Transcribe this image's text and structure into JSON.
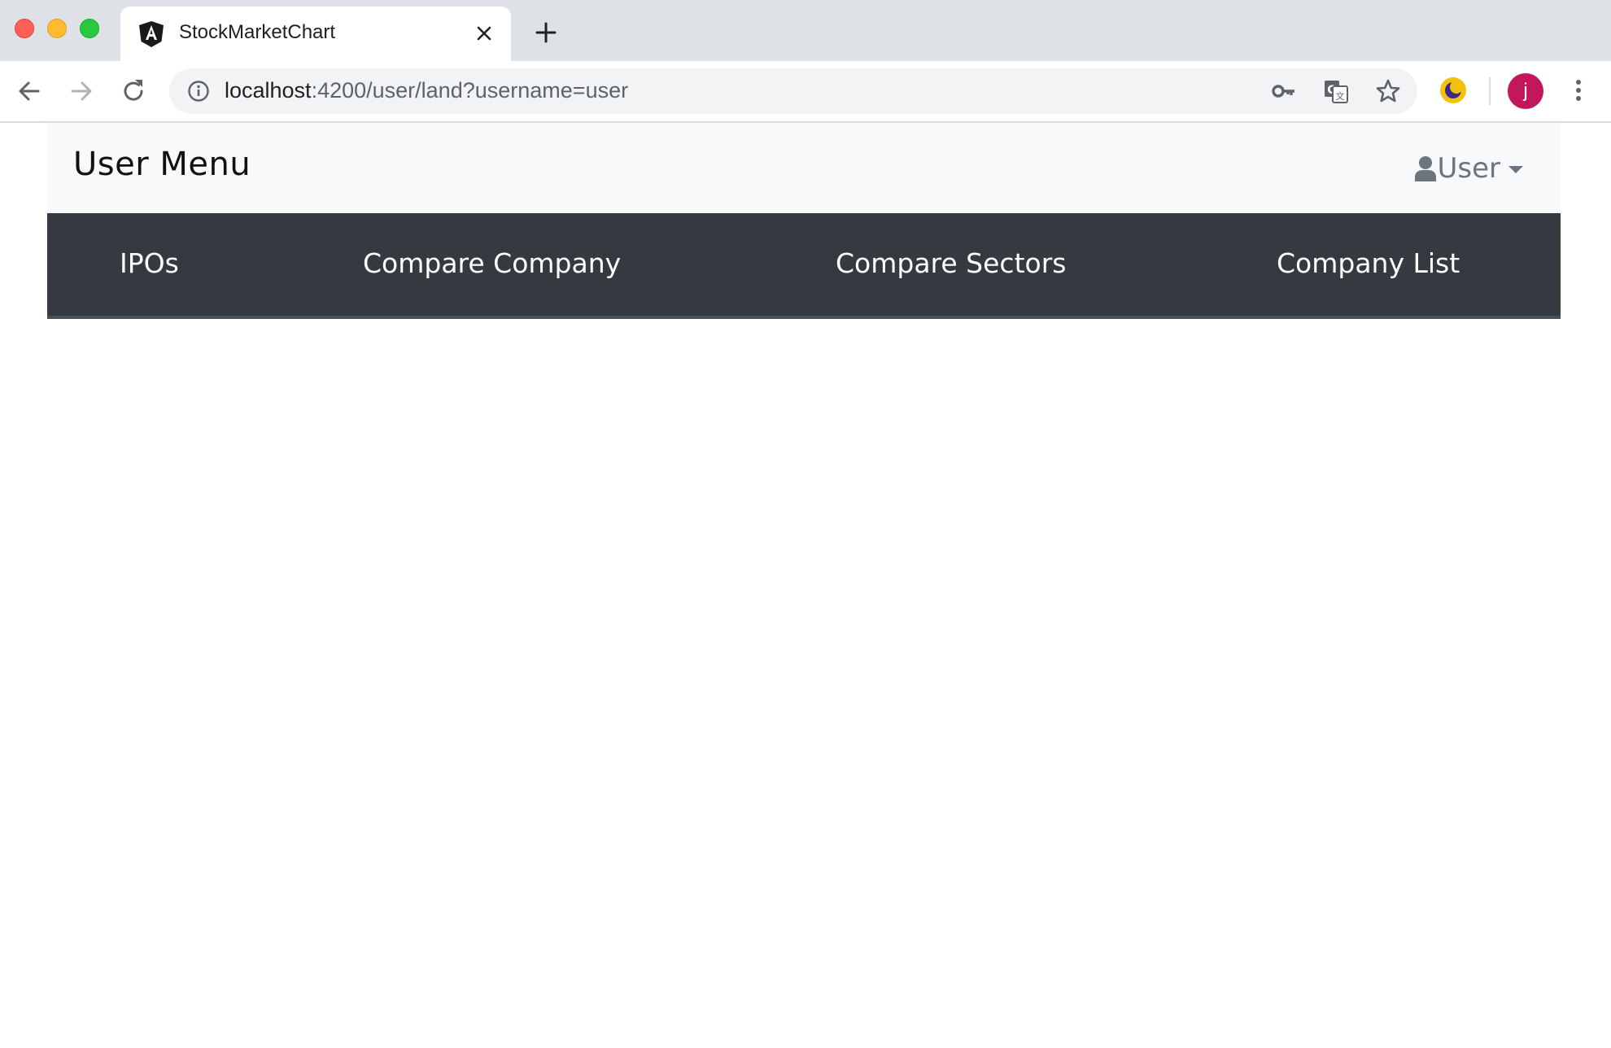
{
  "browser": {
    "tab": {
      "title": "StockMarketChart",
      "favicon": "angular-icon"
    },
    "url": {
      "host": "localhost",
      "path": ":4200/user/land?username=user"
    },
    "profile_initial": "j"
  },
  "header": {
    "brand": "User Menu",
    "user_menu_label": "User"
  },
  "nav": {
    "items": [
      {
        "label": "IPOs"
      },
      {
        "label": "Compare Company"
      },
      {
        "label": "Compare Sectors"
      },
      {
        "label": "Company List"
      }
    ]
  },
  "colors": {
    "header_bg": "#f8f9fa",
    "navbar_bg": "#343a40",
    "nav_text": "#ffffff",
    "avatar_bg": "#c2185b"
  }
}
